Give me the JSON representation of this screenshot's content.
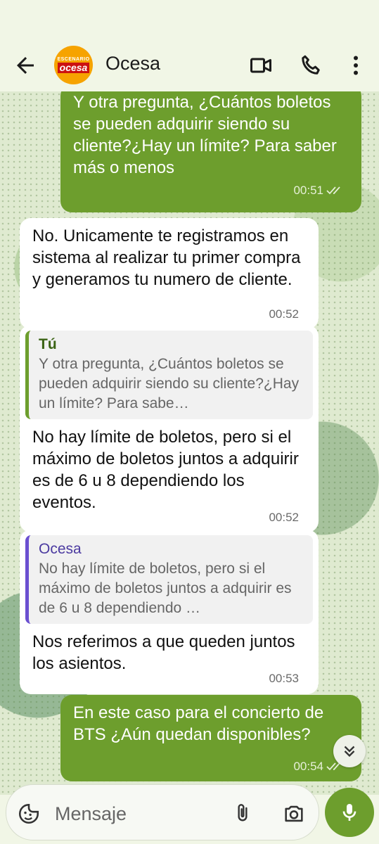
{
  "header": {
    "contact_name": "Ocesa",
    "avatar_top_text": "ESCENARIO",
    "avatar_main_text": "ocesa",
    "icons": [
      "back-arrow-icon",
      "video-call-icon",
      "phone-icon",
      "more-vert-icon"
    ]
  },
  "messages": [
    {
      "direction": "out",
      "text": "Y otra pregunta, ¿Cuántos boletos se pueden adquirir siendo su cliente?¿Hay un límite? Para saber más o menos",
      "time": "00:51",
      "status": "read"
    },
    {
      "direction": "in",
      "text": "No. Unicamente te registramos en sistema al realizar tu primer compra y generamos tu numero de cliente.",
      "time": "00:52"
    },
    {
      "direction": "in",
      "quote": {
        "name": "Tú",
        "text": "Y otra pregunta, ¿Cuántos boletos se pueden adquirir siendo su cliente?¿Hay un límite? Para sabe…"
      },
      "text": "No hay límite de boletos, pero si el máximo de boletos juntos a adquirir es de 6 u 8 dependiendo los eventos.",
      "time": "00:52"
    },
    {
      "direction": "in",
      "quote": {
        "name": "Ocesa",
        "text": "No hay límite de boletos, pero si el máximo de boletos juntos a adquirir es de 6 u 8 dependiendo …"
      },
      "text": "Nos referimos a que queden juntos los asientos.",
      "time": "00:53"
    },
    {
      "direction": "out",
      "text": "En este caso para el concierto de BTS ¿Aún quedan disponibles?",
      "time": "00:54",
      "status": "read"
    }
  ],
  "composer": {
    "placeholder": "Mensaje"
  },
  "colors": {
    "outgoing": "#6d9e2d",
    "incoming": "#ffffff",
    "header_bg": "#f1f6e6",
    "accent": "#6d9e2d"
  }
}
